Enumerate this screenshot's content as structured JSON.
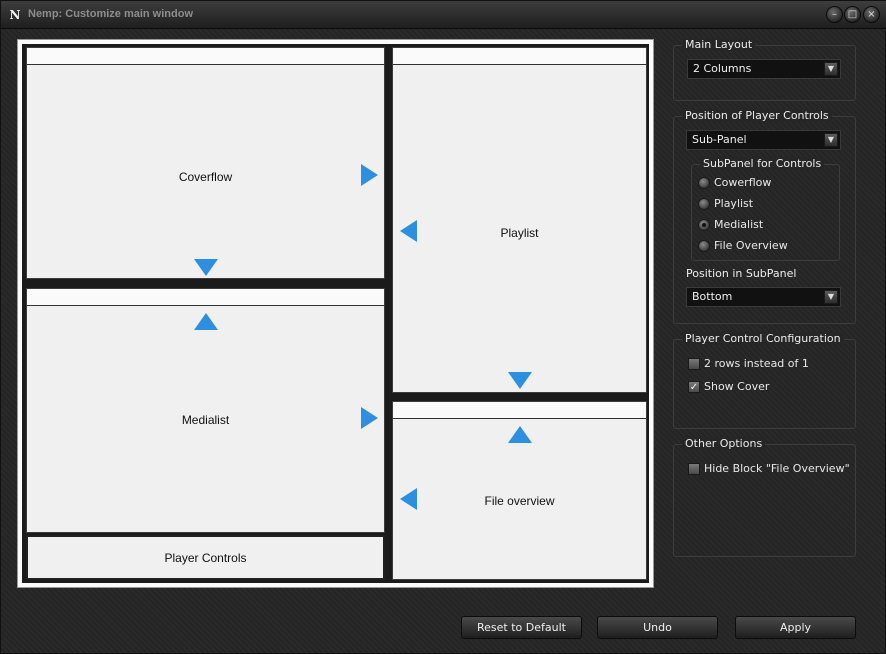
{
  "window": {
    "title": "Nemp: Customize main window",
    "icon_letter": "N",
    "controls": {
      "minimize": "–",
      "maximize": "□",
      "close": "×"
    }
  },
  "layout_preview": {
    "coverflow": "Coverflow",
    "medialist": "Medialist",
    "player_controls": "Player Controls",
    "playlist": "Playlist",
    "file_overview": "File overview",
    "arrow_color": "#2d8fe0"
  },
  "settings": {
    "main_layout": {
      "legend": "Main Layout",
      "value": "2 Columns"
    },
    "player_controls_position": {
      "legend": "Position of Player Controls",
      "value": "Sub-Panel",
      "subpanel": {
        "legend": "SubPanel for Controls",
        "options": [
          {
            "label": "Cowerflow",
            "selected": false
          },
          {
            "label": "Playlist",
            "selected": false
          },
          {
            "label": "Medialist",
            "selected": true
          },
          {
            "label": "File Overview",
            "selected": false
          }
        ]
      },
      "position_label": "Position in SubPanel",
      "position_value": "Bottom"
    },
    "player_control_config": {
      "legend": "Player Control Configuration",
      "two_rows": {
        "label": "2 rows instead of 1",
        "checked": false
      },
      "show_cover": {
        "label": "Show Cover",
        "checked": true
      }
    },
    "other_options": {
      "legend": "Other Options",
      "hide_file_overview": {
        "label": "Hide Block \"File Overview\"",
        "checked": false
      }
    }
  },
  "buttons": {
    "reset": "Reset to Default",
    "undo": "Undo",
    "apply": "Apply"
  }
}
